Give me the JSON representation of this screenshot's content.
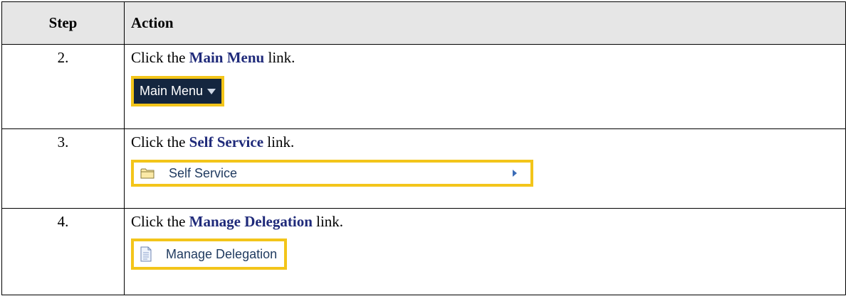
{
  "header": {
    "step": "Step",
    "action": "Action"
  },
  "rows": [
    {
      "step": "2.",
      "before": "Click the ",
      "link": "Main Menu",
      "after": " link.",
      "ui_label": "Main Menu"
    },
    {
      "step": "3.",
      "before": "Click the ",
      "link": "Self Service",
      "after": " link.",
      "ui_label": "Self Service"
    },
    {
      "step": "4.",
      "before": "Click the ",
      "link": "Manage Delegation",
      "after": " link.",
      "ui_label": "Manage Delegation"
    }
  ],
  "icons": {
    "row2": "chevron-down-icon",
    "row3_left": "folder-icon",
    "row3_right": "chevron-right-icon",
    "row4": "document-icon"
  },
  "colors": {
    "highlight": "#f3c51a",
    "link": "#1f2a7a",
    "menu_bg": "#14263f",
    "header_bg": "#e6e6e6"
  }
}
